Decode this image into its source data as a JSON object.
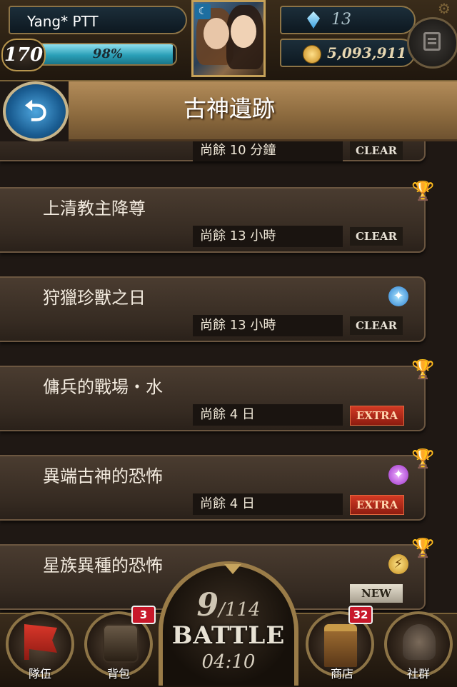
{
  "player": {
    "name": "Yang* PTT",
    "level": "170",
    "exp_percent": "98%",
    "exp_fraction": 0.98
  },
  "currency": {
    "gems": "13",
    "gold": "5,093,911"
  },
  "header": {
    "title": "古神遺跡"
  },
  "dungeons": [
    {
      "title": "",
      "time_left": "尚餘 10 分鐘",
      "status": "CLEAR",
      "icon": ""
    },
    {
      "title": "上清教主降尊",
      "time_left": "尚餘 13 小時",
      "status": "CLEAR",
      "icon": "trophy-icon"
    },
    {
      "title": "狩獵珍獸之日",
      "time_left": "尚餘 13 小時",
      "status": "CLEAR",
      "icon": "blue-orb-icon"
    },
    {
      "title": "傭兵的戰場・水",
      "time_left": "尚餘 4 日",
      "status": "EXTRA",
      "icon": "trophy-icon"
    },
    {
      "title": "異端古神的恐怖",
      "time_left": "尚餘 4 日",
      "status": "EXTRA",
      "icon": "purple-orb-trophy-icon"
    },
    {
      "title": "星族異種的恐怖",
      "time_left": "",
      "status": "NEW",
      "icon": "gold-mark-trophy-icon"
    }
  ],
  "nav": {
    "team": "隊伍",
    "bag": "背包",
    "bag_badge": "3",
    "shop": "商店",
    "shop_badge": "32",
    "social": "社群"
  },
  "battle": {
    "stamina_current": "9",
    "stamina_max": "/114",
    "label": "BATTLE",
    "timer": "04:10"
  },
  "colors": {
    "accent_gold": "#8d7446",
    "exp_bar": "#2a9fb7",
    "extra_badge": "#c2301c",
    "badge_red": "#c8182a"
  }
}
